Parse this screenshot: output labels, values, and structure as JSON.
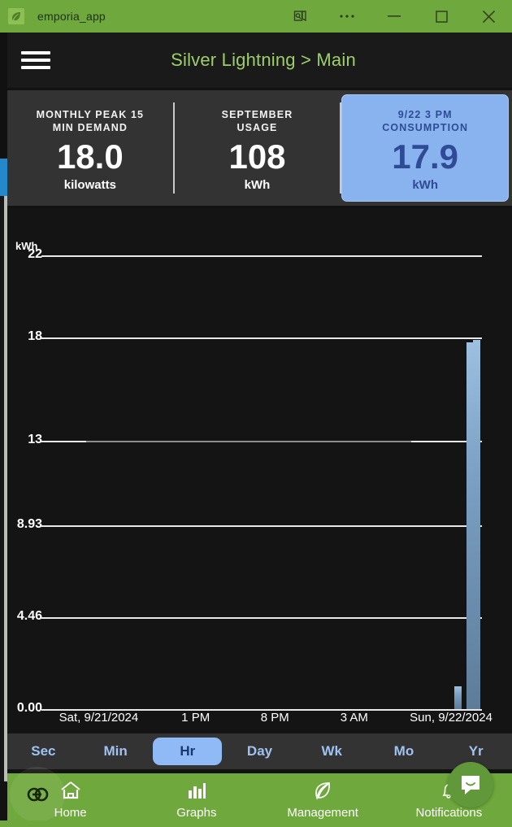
{
  "window": {
    "app_name": "emporia_app",
    "icon": "leaf-icon",
    "controls": [
      {
        "name": "screen-capture-icon",
        "glyph": "capture"
      },
      {
        "name": "more-options-icon",
        "glyph": "ellipsis"
      },
      {
        "name": "minimize-icon",
        "glyph": "minimize"
      },
      {
        "name": "maximize-icon",
        "glyph": "maximize"
      },
      {
        "name": "close-icon",
        "glyph": "close"
      }
    ],
    "titlebar_color": "#6fa83c"
  },
  "header": {
    "menu_icon": "hamburger-menu-icon",
    "title": "Silver Lightning > Main",
    "title_color": "#9ccf6a"
  },
  "stats": [
    {
      "caption": "MONTHLY PEAK 15 MIN DEMAND",
      "value": "18.0",
      "unit": "kilowatts",
      "highlighted": false
    },
    {
      "caption": "SEPTEMBER USAGE",
      "value": "108",
      "unit": "kWh",
      "highlighted": false
    },
    {
      "caption": "9/22 3 PM CONSUMPTION",
      "value": "17.9",
      "unit": "kWh",
      "highlighted": true
    }
  ],
  "stat_captions": {
    "peak_line1": "MONTHLY PEAK 15",
    "peak_line2": "MIN DEMAND",
    "sept_line1": "SEPTEMBER",
    "sept_line2": "USAGE",
    "cons_line1": "9/22 3 PM",
    "cons_line2": "CONSUMPTION"
  },
  "highlight_colors": {
    "background": "#89b3ee",
    "text": "#2f4b96"
  },
  "chart_data": {
    "type": "bar",
    "title": "",
    "xlabel": "",
    "ylabel": "kWh",
    "y_unit_label": "kWh",
    "ylim": [
      0,
      22
    ],
    "yticks": [
      "0.00",
      "4.46",
      "8.93",
      "13",
      "18",
      "22"
    ],
    "ytick_values": [
      0,
      4.46,
      8.93,
      13,
      18,
      22
    ],
    "xtick_labels": [
      "Sat, 9/21/2024",
      "1 PM",
      "8 PM",
      "3 AM",
      "Sun, 9/22/2024"
    ],
    "xtick_positions": [
      0.13,
      0.35,
      0.53,
      0.71,
      0.93
    ],
    "grid": true,
    "legend": "none",
    "bar_color": "#7ca1c4",
    "series": [
      {
        "name": "Consumption",
        "values": [
          {
            "x": 0.945,
            "value": 1.1
          },
          {
            "x": 0.972,
            "value": 17.8
          },
          {
            "x": 0.988,
            "value": 17.9
          }
        ]
      }
    ],
    "average_line_value": 13
  },
  "range_tabs": [
    {
      "label": "Sec",
      "selected": false
    },
    {
      "label": "Min",
      "selected": false
    },
    {
      "label": "Hr",
      "selected": true
    },
    {
      "label": "Day",
      "selected": false
    },
    {
      "label": "Wk",
      "selected": false
    },
    {
      "label": "Mo",
      "selected": false
    },
    {
      "label": "Yr",
      "selected": false
    }
  ],
  "bottom_nav": [
    {
      "label": "Home",
      "icon": "house-icon"
    },
    {
      "label": "Graphs",
      "icon": "bar-chart-icon"
    },
    {
      "label": "Management",
      "icon": "leaf-icon"
    },
    {
      "label": "Notifications",
      "icon": "bell-icon"
    }
  ],
  "overlays": {
    "accessibility_badge": "chain-link-icon",
    "chat_widget": "chat-bubble-icon"
  }
}
